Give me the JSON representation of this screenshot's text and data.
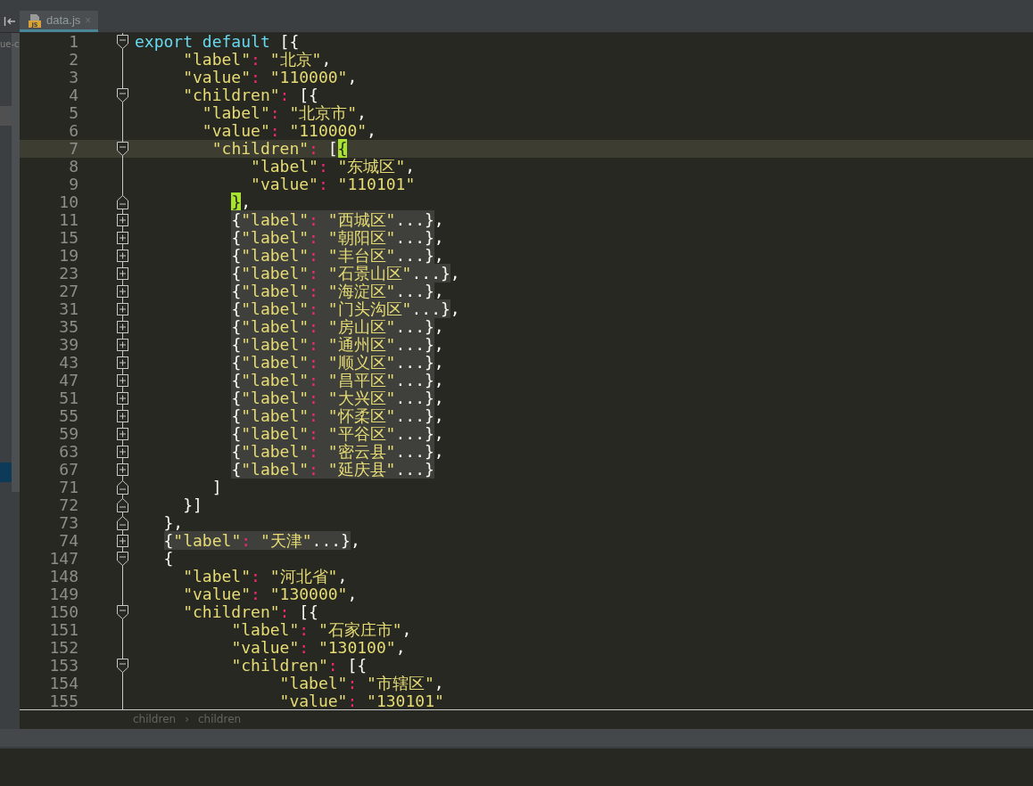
{
  "project_panel": {
    "text": "ue-c"
  },
  "tabs": [
    {
      "label": "data.js",
      "badge": "JS",
      "close": "×",
      "selected": true
    }
  ],
  "editor": {
    "lines": [
      {
        "number": "1",
        "kind": "open",
        "current": false,
        "tokens": [
          {
            "kind": "kw",
            "text": "export default"
          },
          {
            "kind": "punct",
            "text": " [{"
          }
        ]
      },
      {
        "number": "2",
        "kind": "plain",
        "current": false,
        "tokens": [
          {
            "kind": "key",
            "text": "     \"label\""
          },
          {
            "kind": "colon",
            "text": ": "
          },
          {
            "kind": "str",
            "text": "\"北京\""
          },
          {
            "kind": "punct",
            "text": ","
          }
        ]
      },
      {
        "number": "3",
        "kind": "plain",
        "current": false,
        "tokens": [
          {
            "kind": "key",
            "text": "     \"value\""
          },
          {
            "kind": "colon",
            "text": ": "
          },
          {
            "kind": "str",
            "text": "\"110000\""
          },
          {
            "kind": "punct",
            "text": ","
          }
        ]
      },
      {
        "number": "4",
        "kind": "open",
        "current": false,
        "tokens": [
          {
            "kind": "key",
            "text": "     \"children\""
          },
          {
            "kind": "colon",
            "text": ": "
          },
          {
            "kind": "punct",
            "text": "[{"
          }
        ]
      },
      {
        "number": "5",
        "kind": "plain",
        "current": false,
        "tokens": [
          {
            "kind": "key",
            "text": "       \"label\""
          },
          {
            "kind": "colon",
            "text": ": "
          },
          {
            "kind": "str",
            "text": "\"北京市\""
          },
          {
            "kind": "punct",
            "text": ","
          }
        ]
      },
      {
        "number": "6",
        "kind": "plain",
        "current": false,
        "tokens": [
          {
            "kind": "key",
            "text": "       \"value\""
          },
          {
            "kind": "colon",
            "text": ": "
          },
          {
            "kind": "str",
            "text": "\"110000\""
          },
          {
            "kind": "punct",
            "text": ","
          }
        ]
      },
      {
        "number": "7",
        "kind": "open",
        "current": true,
        "tokens": [
          {
            "kind": "key",
            "text": "        \"children\""
          },
          {
            "kind": "colon",
            "text": ": "
          },
          {
            "kind": "punct",
            "text": "["
          },
          {
            "kind": "match",
            "text": "{"
          }
        ]
      },
      {
        "number": "8",
        "kind": "plain",
        "current": false,
        "tokens": [
          {
            "kind": "key",
            "text": "            \"label\""
          },
          {
            "kind": "colon",
            "text": ": "
          },
          {
            "kind": "str",
            "text": "\"东城区\""
          },
          {
            "kind": "punct",
            "text": ","
          }
        ]
      },
      {
        "number": "9",
        "kind": "plain",
        "current": false,
        "tokens": [
          {
            "kind": "key",
            "text": "            \"value\""
          },
          {
            "kind": "colon",
            "text": ": "
          },
          {
            "kind": "str",
            "text": "\"110101\""
          }
        ]
      },
      {
        "number": "10",
        "kind": "close",
        "current": false,
        "tokens": [
          {
            "kind": "match",
            "text": "          }"
          },
          {
            "kind": "punct",
            "text": ","
          }
        ]
      },
      {
        "number": "11",
        "kind": "collapsed",
        "current": false,
        "tokens": [
          {
            "kind": "folded",
            "parts": [
              {
                "kind": "punct",
                "text": "          {"
              },
              {
                "kind": "key",
                "text": "\"label\""
              },
              {
                "kind": "colon",
                "text": ": "
              },
              {
                "kind": "str",
                "text": "\"西城区\""
              },
              {
                "kind": "punct",
                "text": "...}"
              }
            ]
          },
          {
            "kind": "punct",
            "text": ","
          }
        ]
      },
      {
        "number": "15",
        "kind": "collapsed",
        "current": false,
        "tokens": [
          {
            "kind": "folded",
            "parts": [
              {
                "kind": "punct",
                "text": "          {"
              },
              {
                "kind": "key",
                "text": "\"label\""
              },
              {
                "kind": "colon",
                "text": ": "
              },
              {
                "kind": "str",
                "text": "\"朝阳区\""
              },
              {
                "kind": "punct",
                "text": "...}"
              }
            ]
          },
          {
            "kind": "punct",
            "text": ","
          }
        ]
      },
      {
        "number": "19",
        "kind": "collapsed",
        "current": false,
        "tokens": [
          {
            "kind": "folded",
            "parts": [
              {
                "kind": "punct",
                "text": "          {"
              },
              {
                "kind": "key",
                "text": "\"label\""
              },
              {
                "kind": "colon",
                "text": ": "
              },
              {
                "kind": "str",
                "text": "\"丰台区\""
              },
              {
                "kind": "punct",
                "text": "...}"
              }
            ]
          },
          {
            "kind": "punct",
            "text": ","
          }
        ]
      },
      {
        "number": "23",
        "kind": "collapsed",
        "current": false,
        "tokens": [
          {
            "kind": "folded",
            "parts": [
              {
                "kind": "punct",
                "text": "          {"
              },
              {
                "kind": "key",
                "text": "\"label\""
              },
              {
                "kind": "colon",
                "text": ": "
              },
              {
                "kind": "str",
                "text": "\"石景山区\""
              },
              {
                "kind": "punct",
                "text": "...}"
              }
            ]
          },
          {
            "kind": "punct",
            "text": ","
          }
        ]
      },
      {
        "number": "27",
        "kind": "collapsed",
        "current": false,
        "tokens": [
          {
            "kind": "folded",
            "parts": [
              {
                "kind": "punct",
                "text": "          {"
              },
              {
                "kind": "key",
                "text": "\"label\""
              },
              {
                "kind": "colon",
                "text": ": "
              },
              {
                "kind": "str",
                "text": "\"海淀区\""
              },
              {
                "kind": "punct",
                "text": "...}"
              }
            ]
          },
          {
            "kind": "punct",
            "text": ","
          }
        ]
      },
      {
        "number": "31",
        "kind": "collapsed",
        "current": false,
        "tokens": [
          {
            "kind": "folded",
            "parts": [
              {
                "kind": "punct",
                "text": "          {"
              },
              {
                "kind": "key",
                "text": "\"label\""
              },
              {
                "kind": "colon",
                "text": ": "
              },
              {
                "kind": "str",
                "text": "\"门头沟区\""
              },
              {
                "kind": "punct",
                "text": "...}"
              }
            ]
          },
          {
            "kind": "punct",
            "text": ","
          }
        ]
      },
      {
        "number": "35",
        "kind": "collapsed",
        "current": false,
        "tokens": [
          {
            "kind": "folded",
            "parts": [
              {
                "kind": "punct",
                "text": "          {"
              },
              {
                "kind": "key",
                "text": "\"label\""
              },
              {
                "kind": "colon",
                "text": ": "
              },
              {
                "kind": "str",
                "text": "\"房山区\""
              },
              {
                "kind": "punct",
                "text": "...}"
              }
            ]
          },
          {
            "kind": "punct",
            "text": ","
          }
        ]
      },
      {
        "number": "39",
        "kind": "collapsed",
        "current": false,
        "tokens": [
          {
            "kind": "folded",
            "parts": [
              {
                "kind": "punct",
                "text": "          {"
              },
              {
                "kind": "key",
                "text": "\"label\""
              },
              {
                "kind": "colon",
                "text": ": "
              },
              {
                "kind": "str",
                "text": "\"通州区\""
              },
              {
                "kind": "punct",
                "text": "...}"
              }
            ]
          },
          {
            "kind": "punct",
            "text": ","
          }
        ]
      },
      {
        "number": "43",
        "kind": "collapsed",
        "current": false,
        "tokens": [
          {
            "kind": "folded",
            "parts": [
              {
                "kind": "punct",
                "text": "          {"
              },
              {
                "kind": "key",
                "text": "\"label\""
              },
              {
                "kind": "colon",
                "text": ": "
              },
              {
                "kind": "str",
                "text": "\"顺义区\""
              },
              {
                "kind": "punct",
                "text": "...}"
              }
            ]
          },
          {
            "kind": "punct",
            "text": ","
          }
        ]
      },
      {
        "number": "47",
        "kind": "collapsed",
        "current": false,
        "tokens": [
          {
            "kind": "folded",
            "parts": [
              {
                "kind": "punct",
                "text": "          {"
              },
              {
                "kind": "key",
                "text": "\"label\""
              },
              {
                "kind": "colon",
                "text": ": "
              },
              {
                "kind": "str",
                "text": "\"昌平区\""
              },
              {
                "kind": "punct",
                "text": "...}"
              }
            ]
          },
          {
            "kind": "punct",
            "text": ","
          }
        ]
      },
      {
        "number": "51",
        "kind": "collapsed",
        "current": false,
        "tokens": [
          {
            "kind": "folded",
            "parts": [
              {
                "kind": "punct",
                "text": "          {"
              },
              {
                "kind": "key",
                "text": "\"label\""
              },
              {
                "kind": "colon",
                "text": ": "
              },
              {
                "kind": "str",
                "text": "\"大兴区\""
              },
              {
                "kind": "punct",
                "text": "...}"
              }
            ]
          },
          {
            "kind": "punct",
            "text": ","
          }
        ]
      },
      {
        "number": "55",
        "kind": "collapsed",
        "current": false,
        "tokens": [
          {
            "kind": "folded",
            "parts": [
              {
                "kind": "punct",
                "text": "          {"
              },
              {
                "kind": "key",
                "text": "\"label\""
              },
              {
                "kind": "colon",
                "text": ": "
              },
              {
                "kind": "str",
                "text": "\"怀柔区\""
              },
              {
                "kind": "punct",
                "text": "...}"
              }
            ]
          },
          {
            "kind": "punct",
            "text": ","
          }
        ]
      },
      {
        "number": "59",
        "kind": "collapsed",
        "current": false,
        "tokens": [
          {
            "kind": "folded",
            "parts": [
              {
                "kind": "punct",
                "text": "          {"
              },
              {
                "kind": "key",
                "text": "\"label\""
              },
              {
                "kind": "colon",
                "text": ": "
              },
              {
                "kind": "str",
                "text": "\"平谷区\""
              },
              {
                "kind": "punct",
                "text": "...}"
              }
            ]
          },
          {
            "kind": "punct",
            "text": ","
          }
        ]
      },
      {
        "number": "63",
        "kind": "collapsed",
        "current": false,
        "tokens": [
          {
            "kind": "folded",
            "parts": [
              {
                "kind": "punct",
                "text": "          {"
              },
              {
                "kind": "key",
                "text": "\"label\""
              },
              {
                "kind": "colon",
                "text": ": "
              },
              {
                "kind": "str",
                "text": "\"密云县\""
              },
              {
                "kind": "punct",
                "text": "...}"
              }
            ]
          },
          {
            "kind": "punct",
            "text": ","
          }
        ]
      },
      {
        "number": "67",
        "kind": "collapsed",
        "current": false,
        "tokens": [
          {
            "kind": "folded",
            "parts": [
              {
                "kind": "punct",
                "text": "          {"
              },
              {
                "kind": "key",
                "text": "\"label\""
              },
              {
                "kind": "colon",
                "text": ": "
              },
              {
                "kind": "str",
                "text": "\"延庆县\""
              },
              {
                "kind": "punct",
                "text": "...}"
              }
            ]
          }
        ]
      },
      {
        "number": "71",
        "kind": "close",
        "current": false,
        "tokens": [
          {
            "kind": "punct",
            "text": "        ]"
          }
        ]
      },
      {
        "number": "72",
        "kind": "close",
        "current": false,
        "tokens": [
          {
            "kind": "punct",
            "text": "     }]"
          }
        ]
      },
      {
        "number": "73",
        "kind": "close",
        "current": false,
        "tokens": [
          {
            "kind": "punct",
            "text": "   },"
          }
        ]
      },
      {
        "number": "74",
        "kind": "collapsed",
        "current": false,
        "tokens": [
          {
            "kind": "folded",
            "parts": [
              {
                "kind": "punct",
                "text": "   {"
              },
              {
                "kind": "key",
                "text": "\"label\""
              },
              {
                "kind": "colon",
                "text": ": "
              },
              {
                "kind": "str",
                "text": "\"天津\""
              },
              {
                "kind": "punct",
                "text": "...}"
              }
            ]
          },
          {
            "kind": "punct",
            "text": ","
          }
        ]
      },
      {
        "number": "147",
        "kind": "open",
        "current": false,
        "tokens": [
          {
            "kind": "punct",
            "text": "   {"
          }
        ]
      },
      {
        "number": "148",
        "kind": "plain",
        "current": false,
        "tokens": [
          {
            "kind": "key",
            "text": "     \"label\""
          },
          {
            "kind": "colon",
            "text": ": "
          },
          {
            "kind": "str",
            "text": "\"河北省\""
          },
          {
            "kind": "punct",
            "text": ","
          }
        ]
      },
      {
        "number": "149",
        "kind": "plain",
        "current": false,
        "tokens": [
          {
            "kind": "key",
            "text": "     \"value\""
          },
          {
            "kind": "colon",
            "text": ": "
          },
          {
            "kind": "str",
            "text": "\"130000\""
          },
          {
            "kind": "punct",
            "text": ","
          }
        ]
      },
      {
        "number": "150",
        "kind": "open",
        "current": false,
        "tokens": [
          {
            "kind": "key",
            "text": "     \"children\""
          },
          {
            "kind": "colon",
            "text": ": "
          },
          {
            "kind": "punct",
            "text": "[{"
          }
        ]
      },
      {
        "number": "151",
        "kind": "plain",
        "current": false,
        "tokens": [
          {
            "kind": "key",
            "text": "          \"label\""
          },
          {
            "kind": "colon",
            "text": ": "
          },
          {
            "kind": "str",
            "text": "\"石家庄市\""
          },
          {
            "kind": "punct",
            "text": ","
          }
        ]
      },
      {
        "number": "152",
        "kind": "plain",
        "current": false,
        "tokens": [
          {
            "kind": "key",
            "text": "          \"value\""
          },
          {
            "kind": "colon",
            "text": ": "
          },
          {
            "kind": "str",
            "text": "\"130100\""
          },
          {
            "kind": "punct",
            "text": ","
          }
        ]
      },
      {
        "number": "153",
        "kind": "open",
        "current": false,
        "tokens": [
          {
            "kind": "key",
            "text": "          \"children\""
          },
          {
            "kind": "colon",
            "text": ": "
          },
          {
            "kind": "punct",
            "text": "[{"
          }
        ]
      },
      {
        "number": "154",
        "kind": "plain",
        "current": false,
        "tokens": [
          {
            "kind": "key",
            "text": "               \"label\""
          },
          {
            "kind": "colon",
            "text": ": "
          },
          {
            "kind": "str",
            "text": "\"市辖区\""
          },
          {
            "kind": "punct",
            "text": ","
          }
        ]
      },
      {
        "number": "155",
        "kind": "plain",
        "current": false,
        "tokens": [
          {
            "kind": "key",
            "text": "               \"value\""
          },
          {
            "kind": "colon",
            "text": ": "
          },
          {
            "kind": "str",
            "text": "\"130101\""
          }
        ]
      }
    ]
  },
  "breadcrumb": {
    "items": [
      "children",
      "children"
    ],
    "separator": "›"
  }
}
